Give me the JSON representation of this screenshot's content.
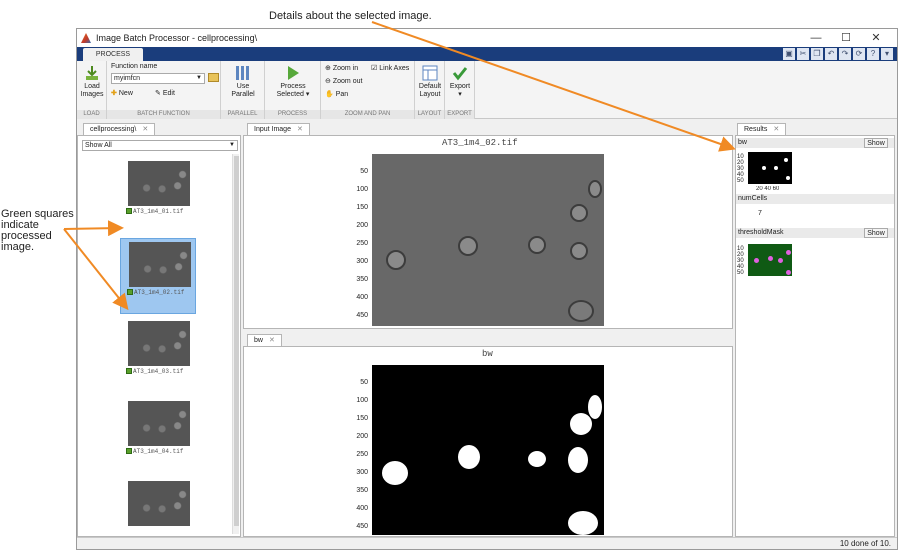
{
  "callouts": {
    "top": "Details about the selected image.",
    "left": [
      "Green squares",
      "indicate",
      "processed",
      "image."
    ]
  },
  "window": {
    "title": "Image Batch Processor - cellprocessing\\",
    "controls": [
      "—",
      "☐",
      "✕"
    ]
  },
  "tabstrip": {
    "active_tab": "PROCESS"
  },
  "toolstrip": {
    "load": {
      "button": [
        "Load",
        "Images"
      ],
      "section": "LOAD"
    },
    "batch": {
      "function_label": "Function name",
      "function_value": "myimfcn",
      "new_label": "New",
      "edit_label": "Edit",
      "section": "BATCH FUNCTION"
    },
    "parallel": {
      "button": [
        "Use",
        "Parallel"
      ],
      "section": "PARALLEL"
    },
    "process": {
      "button": [
        "Process",
        "Selected"
      ],
      "section": "PROCESS"
    },
    "zoom": {
      "zoom_in": "Zoom in",
      "zoom_out": "Zoom out",
      "pan": "Pan",
      "link_axes": "Link Axes",
      "link_axes_checked": true,
      "section": "ZOOM AND PAN"
    },
    "layout": {
      "button": [
        "Default",
        "Layout"
      ],
      "section": "LAYOUT"
    },
    "export": {
      "button": [
        "Export"
      ],
      "section": "EXPORT"
    }
  },
  "left_panel": {
    "tab": "cellprocessing\\",
    "filter_value": "Show All",
    "items": [
      {
        "label": "AT3_1m4_01.tif",
        "processed": true,
        "selected": false
      },
      {
        "label": "AT3_1m4_02.tif",
        "processed": true,
        "selected": true
      },
      {
        "label": "AT3_1m4_03.tif",
        "processed": true,
        "selected": false
      },
      {
        "label": "AT3_1m4_04.tif",
        "processed": true,
        "selected": false
      },
      {
        "label": "",
        "processed": false,
        "selected": false
      }
    ]
  },
  "input_image": {
    "tab": "Input Image",
    "title": "AT3_1m4_02.tif",
    "yticks": [
      "50",
      "100",
      "150",
      "200",
      "250",
      "300",
      "350",
      "400",
      "450"
    ]
  },
  "bw_image": {
    "tab": "bw",
    "title": "bw",
    "yticks": [
      "50",
      "100",
      "150",
      "200",
      "250",
      "300",
      "350",
      "400",
      "450"
    ]
  },
  "results": {
    "tab": "Results",
    "bw_label": "bw",
    "bw_yticks": [
      "10",
      "20",
      "30",
      "40",
      "50"
    ],
    "bw_xticks": "20  40  60",
    "show_label": "Show",
    "numcells_label": "numCells",
    "numcells_value": "7",
    "threshold_label": "thresholdMask",
    "threshold_yticks": [
      "10",
      "20",
      "30",
      "40",
      "50"
    ]
  },
  "status": {
    "text": "10 done of 10."
  }
}
